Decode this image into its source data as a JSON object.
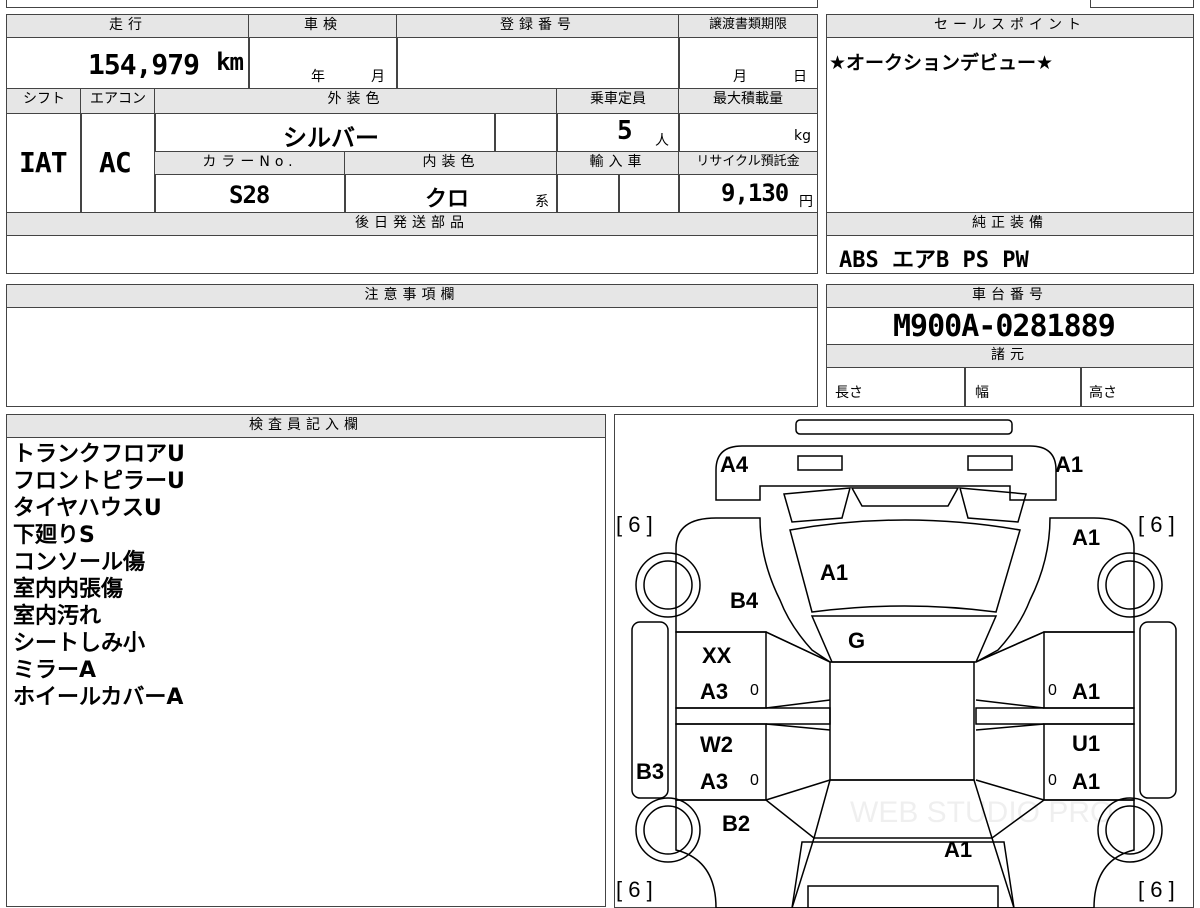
{
  "mileage": {
    "label": "走行",
    "value": "154,979",
    "unit": "km"
  },
  "inspection": {
    "label": "車検",
    "year": "年",
    "month": "月"
  },
  "registration": {
    "label": "登録番号"
  },
  "transfer_deadline": {
    "label": "譲渡書類期限",
    "month": "月",
    "day": "日"
  },
  "sales_point": {
    "label": "セールスポイント",
    "text": "★オークションデビュー★"
  },
  "shift": {
    "label": "シフト",
    "value": "IAT"
  },
  "aircon": {
    "label": "エアコン",
    "value": "AC"
  },
  "exterior_color": {
    "label": "外装色",
    "value": "シルバー"
  },
  "capacity": {
    "label": "乗車定員",
    "value": "5",
    "unit": "人"
  },
  "max_load": {
    "label": "最大積載量",
    "unit": "kg"
  },
  "color_no": {
    "label": "カラーNo.",
    "value": "S28"
  },
  "interior_color": {
    "label": "内装色",
    "value": "クロ",
    "suffix": "系"
  },
  "import": {
    "label": "輸入車"
  },
  "recycle": {
    "label": "リサイクル預託金",
    "value": "9,130",
    "unit": "円"
  },
  "deferred_parts": {
    "label": "後日発送部品"
  },
  "equipment": {
    "label": "純正装備",
    "value": "ABS エアB PS PW"
  },
  "notes": {
    "label": "注意事項欄"
  },
  "chassis": {
    "label": "車台番号",
    "value": "M900A-0281889"
  },
  "specs": {
    "label": "諸元",
    "length": "長さ",
    "width": "幅",
    "height": "高さ"
  },
  "inspector": {
    "label": "検査員記入欄",
    "remarks": [
      "トランクフロアU",
      "フロントピラーU",
      "タイヤハウスU",
      "下廻りS",
      "コンソール傷",
      "室内内張傷",
      "室内汚れ",
      "シートしみ小",
      "ミラーA",
      "ホイールカバーA"
    ]
  },
  "diagram": {
    "rear_left": "A4",
    "rear_right": "A1",
    "tire_rl": "[ 6 ]",
    "tire_rr": "[ 6 ]",
    "tire_fl": "[ 6 ]",
    "tire_fr": "[ 6 ]",
    "rear_quarter_right": "A1",
    "rear_glass": "A1",
    "rear_pillar_left": "B4",
    "roof": "G",
    "rear_door_left_1": "XX",
    "rear_door_left_2": "A3",
    "rear_door_left_small": "0",
    "rear_door_right_small": "0",
    "rear_door_right": "A1",
    "front_door_left_1": "W2",
    "front_door_left_2": "A3",
    "front_door_left_small": "0",
    "front_door_right_1": "U1",
    "front_door_right_small": "0",
    "front_door_right_2": "A1",
    "side_left": "B3",
    "front_fender_left": "B2",
    "hood": "A1",
    "watermark": "WEB STUDIO PRO"
  }
}
